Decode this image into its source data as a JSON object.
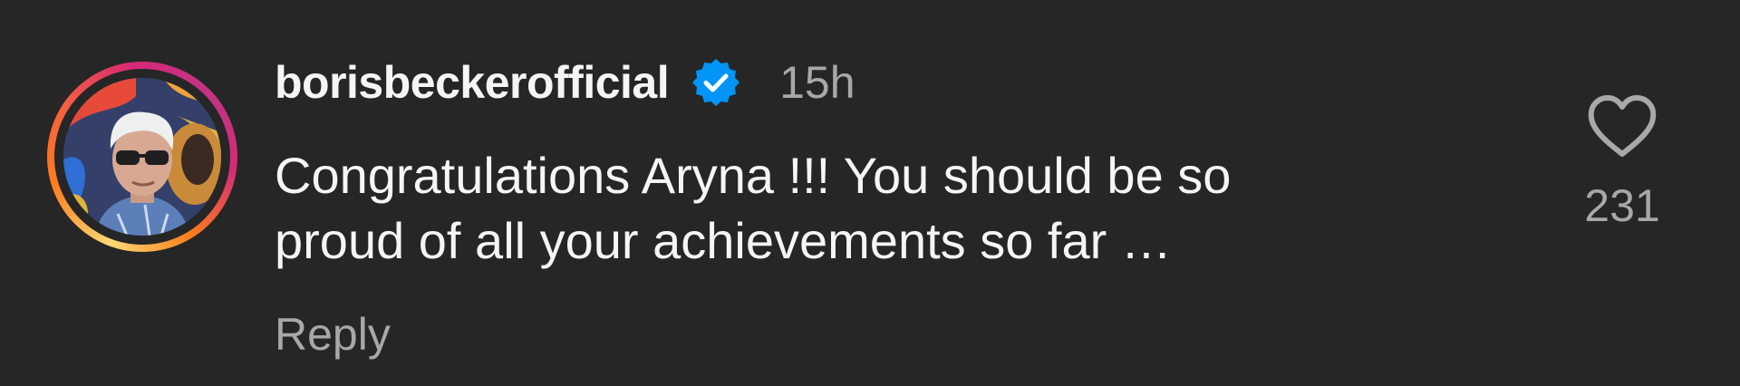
{
  "comment": {
    "username": "borisbeckerofficial",
    "verified_icon": "verified-badge-icon",
    "timestamp": "15h",
    "text_lines": [
      "Congratulations Aryna !!! You should be so",
      "proud of all your achievements so far …"
    ],
    "reply_label": "Reply",
    "like_icon": "heart-outline-icon",
    "like_count": "231"
  },
  "colors": {
    "background": "#262626",
    "primary_text": "#f5f5f5",
    "secondary_text": "#a8a8a8",
    "verified_blue": "#0095f6"
  }
}
